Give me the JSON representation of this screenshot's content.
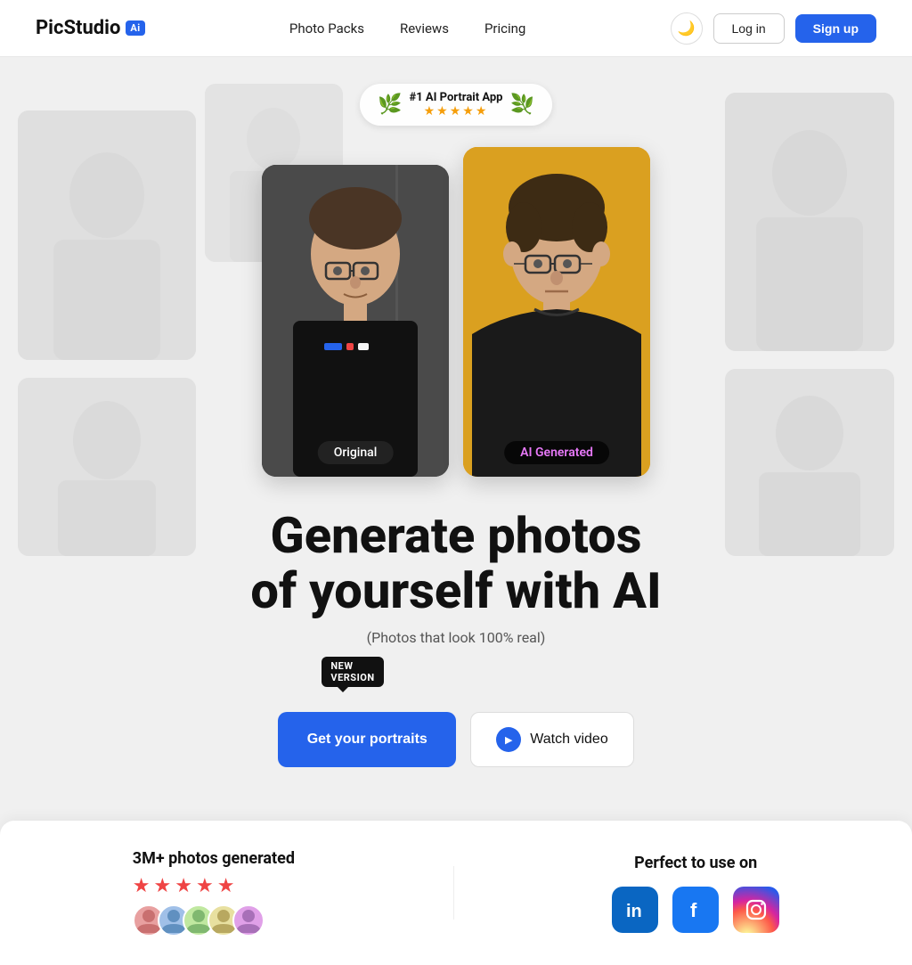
{
  "app": {
    "name": "PicStudio",
    "ai_badge": "Ai"
  },
  "navbar": {
    "links": [
      {
        "id": "photo-packs",
        "label": "Photo Packs"
      },
      {
        "id": "reviews",
        "label": "Reviews"
      },
      {
        "id": "pricing",
        "label": "Pricing"
      }
    ],
    "login_label": "Log in",
    "signup_label": "Sign up",
    "theme_icon": "🌙"
  },
  "award": {
    "title": "#1 AI Portrait App",
    "stars": "★★★★★"
  },
  "photo_labels": {
    "original": "Original",
    "generated": "AI Generated"
  },
  "hero": {
    "heading_line1": "Generate photos",
    "heading_line2": "of yourself with AI",
    "subtext": "(Photos that look 100% real)",
    "new_version_line1": "NEW",
    "new_version_line2": "VERSION",
    "cta_primary": "Get your portraits",
    "cta_secondary": "Watch video"
  },
  "stats": {
    "photos_generated": "3M+ photos generated",
    "perfect_for": "Perfect to use on"
  },
  "social": [
    {
      "name": "linkedin",
      "icon": "in"
    },
    {
      "name": "facebook",
      "icon": "f"
    },
    {
      "name": "instagram",
      "icon": "📷"
    }
  ],
  "colors": {
    "primary_blue": "#2563eb",
    "generated_bg": "#e8a020",
    "original_bg": "#4a4a4a"
  }
}
